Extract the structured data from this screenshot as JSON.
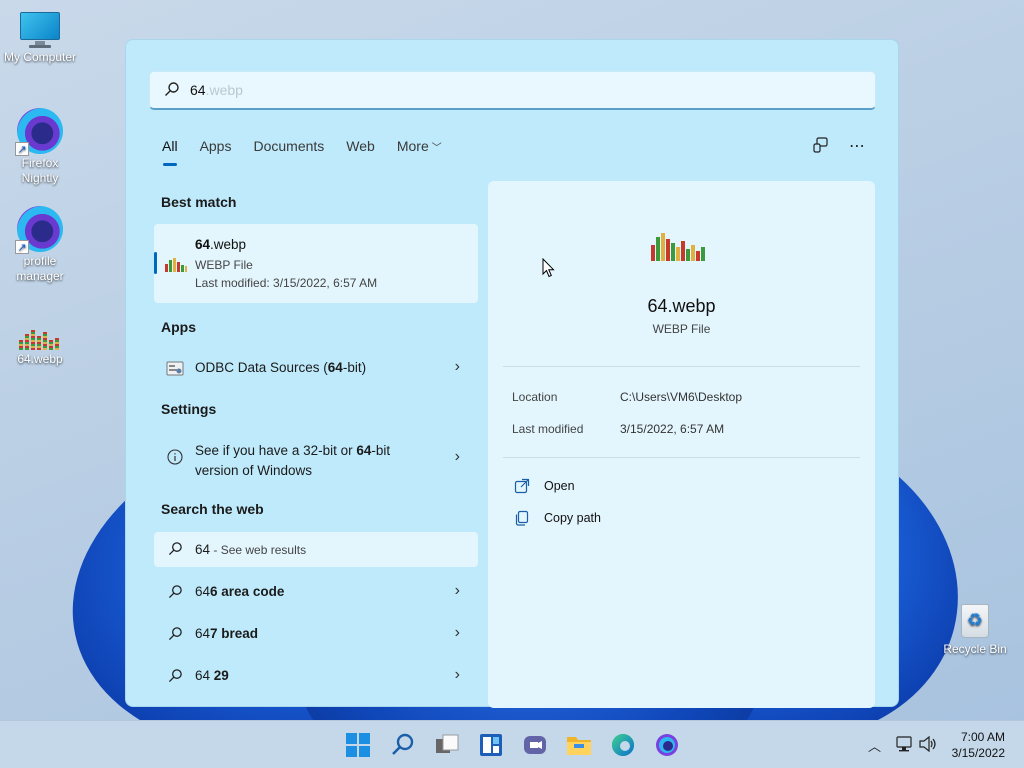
{
  "desktop": {
    "icons": [
      {
        "label": "My Computer"
      },
      {
        "label": "Firefox Nightly"
      },
      {
        "label": "profile manager"
      },
      {
        "label": "64.webp"
      },
      {
        "label": "Recycle Bin"
      }
    ]
  },
  "search": {
    "query": "64",
    "autocomplete": ".webp"
  },
  "tabs": [
    {
      "label": "All",
      "active": true
    },
    {
      "label": "Apps"
    },
    {
      "label": "Documents"
    },
    {
      "label": "Web"
    },
    {
      "label": "More"
    }
  ],
  "results": {
    "best_match_heading": "Best match",
    "best_match": {
      "name_prefix": "64",
      "name_suffix": ".webp",
      "type": "WEBP File",
      "modified": "Last modified: 3/15/2022, 6:57 AM"
    },
    "apps_heading": "Apps",
    "apps": [
      {
        "text_pre": "ODBC Data Sources (",
        "text_bold": "64",
        "text_post": "-bit)"
      }
    ],
    "settings_heading": "Settings",
    "settings": [
      {
        "line1_pre": "See if you have a 32-bit or ",
        "line1_bold": "64",
        "line1_post": "-bit",
        "line2": "version of Windows"
      }
    ],
    "web_heading": "Search the web",
    "web_first": {
      "query": "64",
      "suffix": " - See web results"
    },
    "web": [
      {
        "pre": "64",
        "bold": "6 area code"
      },
      {
        "pre": "64",
        "bold": "7 bread"
      },
      {
        "pre": "64",
        "bold": " 29"
      }
    ]
  },
  "preview": {
    "name": "64.webp",
    "type": "WEBP File",
    "location_label": "Location",
    "location_value": "C:\\Users\\VM6\\Desktop",
    "modified_label": "Last modified",
    "modified_value": "3/15/2022, 6:57 AM",
    "actions": [
      {
        "label": "Open",
        "icon": "open-external-icon"
      },
      {
        "label": "Copy path",
        "icon": "copy-icon"
      }
    ]
  },
  "taskbar": {
    "icons": [
      "windows-start-icon",
      "search-icon",
      "task-view-icon",
      "widgets-icon",
      "teams-chat-icon",
      "file-explorer-icon",
      "edge-icon",
      "firefox-nightly-icon"
    ],
    "time": "7:00 AM",
    "date": "3/15/2022"
  },
  "colors": {
    "accent": "#0067c0",
    "panel_bg": "#bfeafb",
    "card_bg": "#e3f6fd"
  }
}
